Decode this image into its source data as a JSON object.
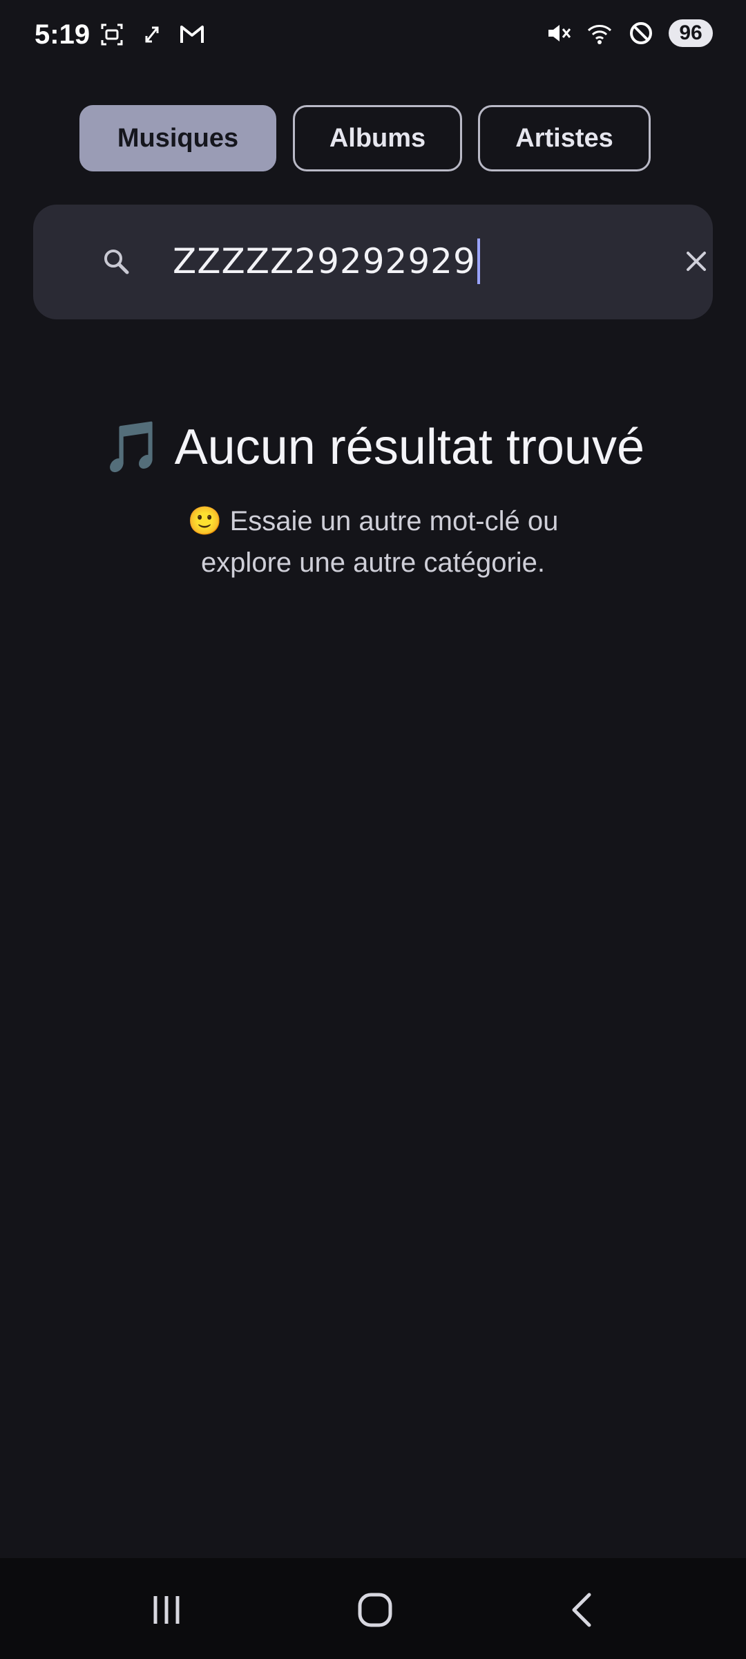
{
  "status_bar": {
    "time": "5:19",
    "battery": "96",
    "left_icons": [
      "screenshot-icon",
      "sync-icon",
      "gmail-icon"
    ],
    "right_icons": [
      "mute-icon",
      "wifi-icon",
      "do-not-disturb-icon"
    ]
  },
  "tabs": [
    {
      "label": "Musiques",
      "active": true
    },
    {
      "label": "Albums",
      "active": false
    },
    {
      "label": "Artistes",
      "active": false
    }
  ],
  "search": {
    "value": "ZZZZZ29292929",
    "icon": "search-icon",
    "clear_icon": "close-icon"
  },
  "empty_state": {
    "title_emoji": "🎵",
    "title": "Aucun résultat trouvé",
    "subtitle_emoji": "🙂",
    "subtitle": "Essaie un autre mot-clé ou explore une autre catégorie."
  },
  "colors": {
    "background": "#141419",
    "tab_active": "#9a9cb5",
    "search_bg": "#2a2a34",
    "caret": "#9aa4ff"
  },
  "nav_bar": {
    "buttons": [
      "recents-icon",
      "home-icon",
      "back-icon"
    ]
  }
}
